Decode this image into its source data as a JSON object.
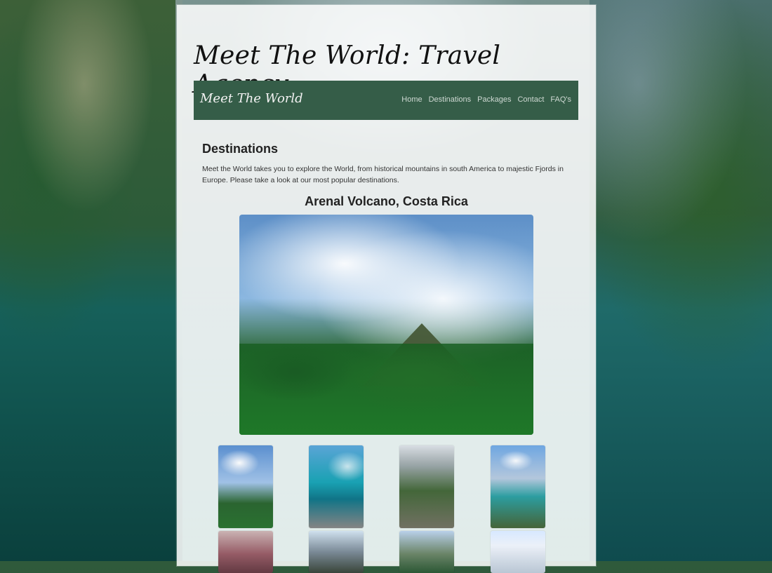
{
  "colors": {
    "accent": "#355d48"
  },
  "header": {
    "site_title": "Meet The World: Travel Agency"
  },
  "navbar": {
    "brand": "Meet The World",
    "links": [
      "Home",
      "Destinations",
      "Packages",
      "Contact",
      "FAQ's"
    ]
  },
  "destinations": {
    "title": "Destinations",
    "text": "Meet the World takes you to explore the World, from historical mountains in south America to majestic Fjords in Europe. Please take a look at our most popular destinations.",
    "featured_title": "Arenal Volcano, Costa Rica"
  }
}
